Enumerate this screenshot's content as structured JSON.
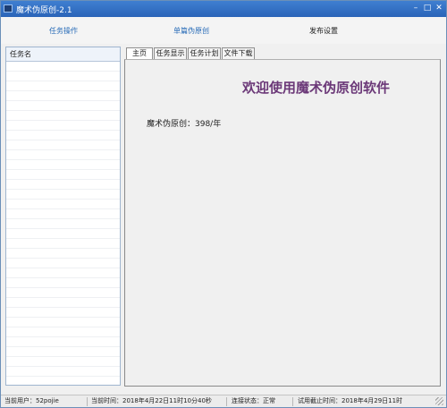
{
  "window": {
    "title": "魔术伪原创-2.1",
    "controls": [
      "minimize-icon",
      "maximize-icon",
      "close-icon"
    ]
  },
  "menu": {
    "task_ops": "任务操作",
    "single_rewrite": "单篇伪原创",
    "publish_settings": "发布设置"
  },
  "left_panel": {
    "header": "任务名"
  },
  "tabs": [
    "主页",
    "任务显示",
    "任务计划",
    "文件下载"
  ],
  "home": {
    "welcome": "欢迎使用魔术伪原创软件",
    "price": "魔术伪原创：398/年"
  },
  "status": {
    "user": "当前用户：52pojie",
    "time": "当前时间：2018年4月22日11时10分40秒",
    "connection": "连接状态：正常",
    "expire": "试用截止时间：2018年4月29日11时"
  },
  "colors": {
    "titlebar": "#2a64b8",
    "welcome_text": "#6b3878",
    "menu_link": "#2a6db8"
  }
}
